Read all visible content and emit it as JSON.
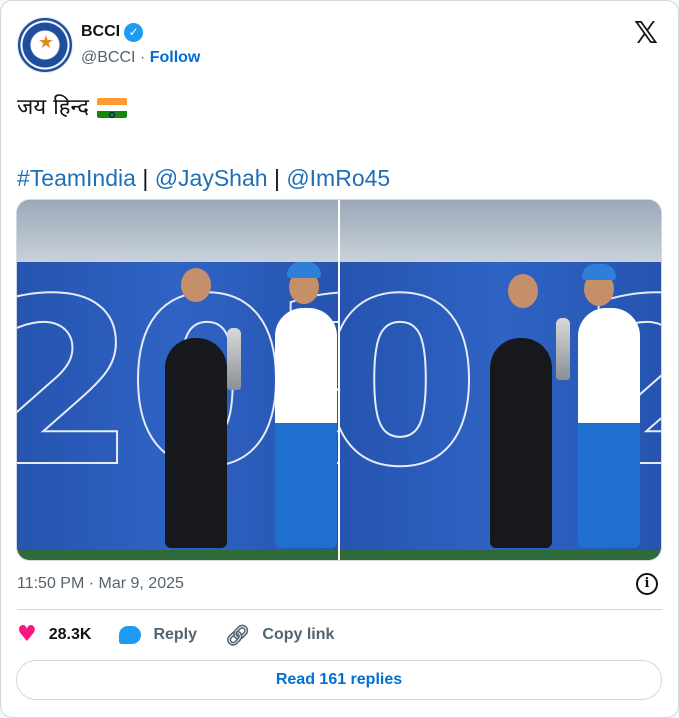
{
  "author": {
    "display_name": "BCCI",
    "handle": "@BCCI",
    "separator": "·",
    "follow_label": "Follow",
    "verified": true
  },
  "tweet": {
    "text_line1": "जय हिन्द",
    "hashtag": "#TeamIndia",
    "sep1": "|",
    "mention1": "@JayShah",
    "sep2": "|",
    "mention2": "@ImRo45"
  },
  "media": {
    "photo_count": 2
  },
  "meta": {
    "timestamp": "11:50 PM · Mar 9, 2025"
  },
  "actions": {
    "like_count": "28.3K",
    "reply_label": "Reply",
    "copy_link_label": "Copy link"
  },
  "footer": {
    "read_replies_label": "Read 161 replies"
  },
  "colors": {
    "link": "#1d6fb8",
    "follow": "#006fd6",
    "heart": "#f91880",
    "verified": "#1d9bf0"
  }
}
